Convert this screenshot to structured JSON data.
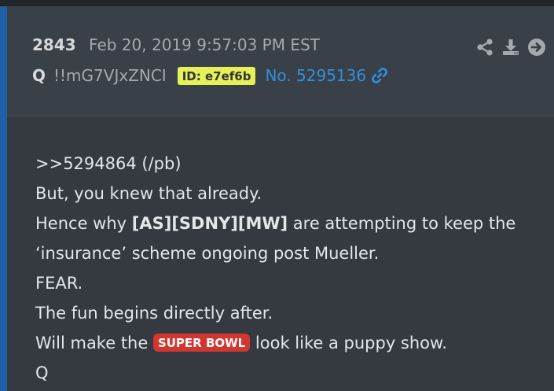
{
  "post": {
    "number": "2843",
    "date": "Feb 20, 2019 9:57:03 PM EST",
    "author": "Q",
    "tripcode": "!!mG7VJxZNCI",
    "id_badge": "ID: e7ef6b",
    "post_no": "No. 5295136"
  },
  "toolbar": {
    "icons": [
      "share-icon",
      "download-icon",
      "arrow-right-circle-icon"
    ]
  },
  "body": {
    "line1": ">>5294864 (/pb)",
    "line2": "But, you knew that already.",
    "line3_pre": "Hence why ",
    "line3_bold": "[AS][SDNY][MW]",
    "line3_post": " are attempting to keep the",
    "line4": "‘insurance’ scheme ongoing post Mueller.",
    "line5": "FEAR.",
    "line6": "The fun begins directly after.",
    "line7_pre": "Will make the ",
    "line7_badge": "SUPER BOWL",
    "line7_post": " look like a puppy show.",
    "line8": "Q"
  },
  "colors": {
    "accent": "#1f5fa6",
    "id_badge": "#e6f059",
    "link": "#2f8fe0",
    "super_bowl_badge": "#d2372f"
  }
}
